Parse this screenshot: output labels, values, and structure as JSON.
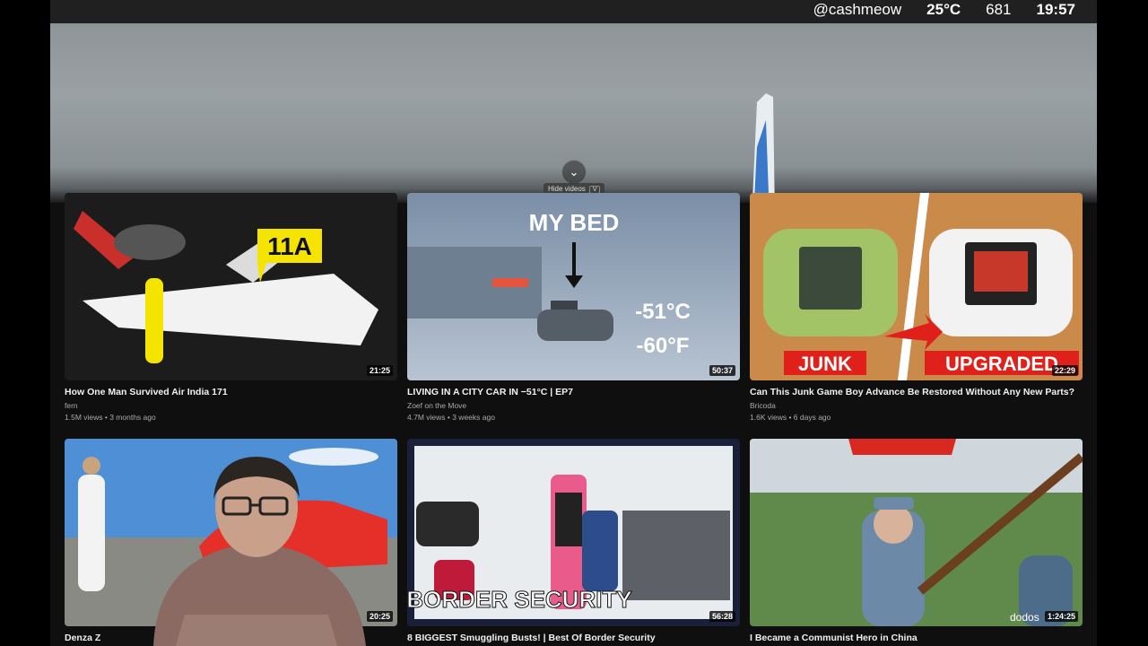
{
  "hud": {
    "handle": "@cashmeow",
    "temperature": "25°C",
    "count": "681",
    "time": "19:57"
  },
  "hero": {
    "hide_label": "Hide videos",
    "hide_key": "V"
  },
  "videos": [
    {
      "title": "How One Man Survived Air India 171",
      "channel": "fern",
      "meta": "1.5M views • 3 months ago",
      "duration": "21:25",
      "thumb_text": "11A"
    },
    {
      "title": "LIVING IN A CITY CAR IN −51°C | EP7",
      "channel": "Zoef on the Move",
      "meta": "4.7M views • 3 weeks ago",
      "duration": "50:37",
      "thumb_text": "MY BED",
      "thumb_text2": "-51°C",
      "thumb_text3": "-60°F"
    },
    {
      "title": "Can This Junk Game Boy Advance Be Restored Without Any New Parts?",
      "channel": "Bricoda",
      "meta": "1.6K views • 6 days ago",
      "duration": "22:29",
      "thumb_text": "JUNK",
      "thumb_text2": "UPGRADED"
    },
    {
      "title": "Denza Z",
      "duration": "20:25"
    },
    {
      "title": "8 BIGGEST Smuggling Busts! | Best Of Border Security",
      "duration": "56:28",
      "thumb_text": "BORDER SECURITY"
    },
    {
      "title": "I Became a Communist Hero in China",
      "duration": "1:24:25",
      "thumb_text": "dodos"
    }
  ]
}
